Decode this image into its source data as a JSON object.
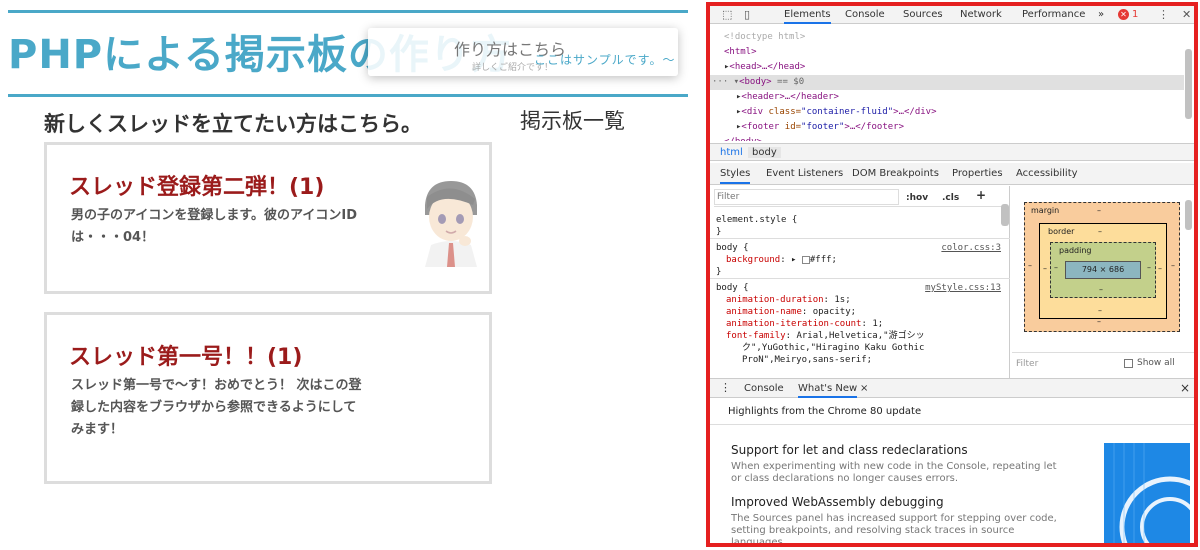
{
  "site": {
    "title": "PHPによる掲示板の作り方",
    "popup_title": "作り方はこちら",
    "popup_subtitle": "詳しくご紹介です！",
    "marquee": "ここはサンプルです。～",
    "new_thread_link": "新しくスレッドを立てたい方はこちら。",
    "board_list_heading": "掲示板一覧",
    "threads": [
      {
        "title": "スレッド登録第二弾！(1)",
        "body": "男の子のアイコンを登録します。彼のアイコンIDは・・・04！",
        "has_avatar": true
      },
      {
        "title": "スレッド第一号！！(1)",
        "body": "スレッド第一号で～す！おめでとう！ 次はこの登録した内容をブラウザから参照できるようにしてみます！",
        "has_avatar": false
      }
    ]
  },
  "devtools": {
    "tabs": [
      "Elements",
      "Console",
      "Sources",
      "Network",
      "Performance",
      "»"
    ],
    "active_tab": "Elements",
    "error_count": "1",
    "dom": {
      "doctype": "<!doctype html>",
      "html_open": "<html>",
      "head": "<head>…</head>",
      "body_open": "<body>",
      "body_eq": "== $0",
      "header": "<header>…</header>",
      "div_tag": "<div ",
      "div_attr": "class=",
      "div_val": "\"container-fluid\"",
      "div_rest": ">…</div>",
      "footer_tag": "<footer ",
      "footer_attr": "id=",
      "footer_val": "\"footer\"",
      "footer_rest": ">…</footer>",
      "truncated": "</body>"
    },
    "breadcrumbs": [
      "html",
      "body"
    ],
    "subtabs": [
      "Styles",
      "Event Listeners",
      "DOM Breakpoints",
      "Properties",
      "Accessibility"
    ],
    "styles": {
      "filter_placeholder": "Filter",
      "hov": ":hov",
      "cls": ".cls",
      "plus": "+",
      "element_style": "element.style {",
      "close": "}",
      "rule1_selector": "body {",
      "rule1_source": "color.css:3",
      "rule1_prop": "background",
      "rule1_value": "#fff;",
      "rule2_selector": "body {",
      "rule2_source": "myStyle.css:13",
      "rule2_props": [
        {
          "prop": "animation-duration",
          "value": "1s;"
        },
        {
          "prop": "animation-name",
          "value": "opacity;"
        },
        {
          "prop": "animation-iteration-count",
          "value": "1;"
        },
        {
          "prop": "font-family",
          "value": "Arial,Helvetica,\"游ゴシッ"
        }
      ],
      "font_cont1": "ク\",YuGothic,\"Hiragino Kaku Gothic",
      "font_cont2": "ProN\",Meiryo,sans-serif;"
    },
    "box_model": {
      "margin": "margin",
      "border": "border",
      "padding": "padding",
      "content": "794 × 686",
      "dash": "–",
      "filter": "Filter",
      "show_all": "Show all"
    },
    "drawer": {
      "tabs": [
        "Console",
        "What's New"
      ],
      "close": "×",
      "header": "Highlights from the Chrome 80 update",
      "items": [
        {
          "title": "Support for let and class redeclarations",
          "text": "When experimenting with new code in the Console, repeating let or class declarations no longer causes errors."
        },
        {
          "title": "Improved WebAssembly debugging",
          "text": "The Sources panel has increased support for stepping over code, setting breakpoints, and resolving stack traces in source languages."
        }
      ]
    }
  }
}
